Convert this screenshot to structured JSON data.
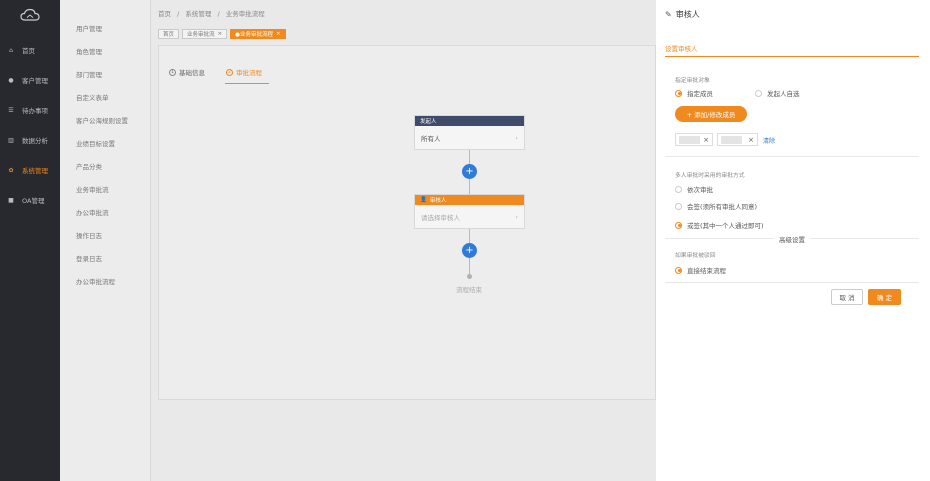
{
  "nav": {
    "items": [
      {
        "icon": "home-icon",
        "label": "首页"
      },
      {
        "icon": "customer-icon",
        "label": "客户管理"
      },
      {
        "icon": "todo-icon",
        "label": "待办事项"
      },
      {
        "icon": "chart-icon",
        "label": "数据分析"
      },
      {
        "icon": "gear-icon",
        "label": "系统管理"
      },
      {
        "icon": "oa-icon",
        "label": "OA管理"
      }
    ]
  },
  "submenu": {
    "items": [
      "用户管理",
      "角色管理",
      "部门管理",
      "自定义表单",
      "客户公海规则设置",
      "业绩目标设置",
      "产品分类",
      "业务审批流",
      "办公审批流",
      "操作日志",
      "登录日志",
      "办公审批流程"
    ]
  },
  "breadcrumb": {
    "home": "首页",
    "sep": "/",
    "section": "系统管理",
    "current": "业务审批流程"
  },
  "tabs": [
    {
      "label": "首页"
    },
    {
      "label": "业务审批流"
    },
    {
      "label": "●业务审批流程"
    }
  ],
  "main": {
    "steps": [
      {
        "num": "1",
        "label": "基础信息"
      },
      {
        "num": "2",
        "label": "审批流程"
      }
    ],
    "start_node": {
      "title": "发起人",
      "body": "所有人"
    },
    "approver_node": {
      "title": "审核人",
      "body": "请选择审核人"
    },
    "end_label": "流程结束",
    "colors": {
      "start": "#3f4b6a",
      "approver": "#f08a1e",
      "plus": "#2f7bd6"
    }
  },
  "panel": {
    "title": "审核人",
    "tab": "设置审核人",
    "target_label": "指定审批对象",
    "target_options": [
      "指定成员",
      "发起人自选"
    ],
    "add_button": "+ 添加/修改成员",
    "chip_close": "×",
    "clear_link": "清除",
    "multi_label": "多人审批时采用的审批方式",
    "multi_options": [
      "依次审批",
      "会签(须所有审批人同意)",
      "或签(其中一个人通过即可)"
    ],
    "advanced_label": "高级设置",
    "empty_label": "如果审批被驳回",
    "empty_option": "直接结束流程",
    "cancel": "取 消",
    "confirm": "确 定",
    "accent": "#f08a1e"
  }
}
